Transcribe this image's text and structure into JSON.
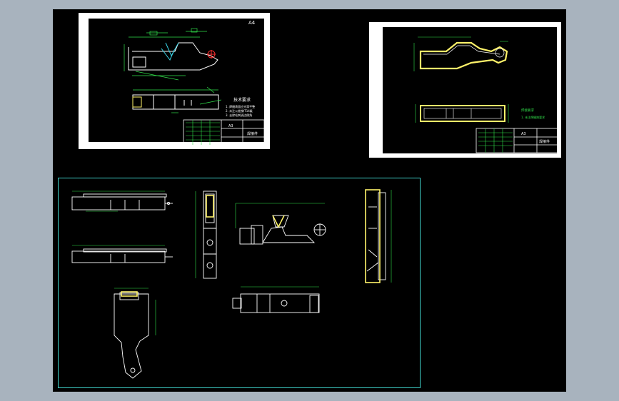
{
  "drawing_sheet_1": {
    "corner_label": "A4",
    "notes_title": "技术要求",
    "notes": [
      "1. 焊缝表面应光滑平整",
      "2. 未注公差按IT14级",
      "3. 去除毛刺锐边倒角"
    ],
    "title_block_name": "焊接件",
    "title_block_code": "A3"
  },
  "drawing_sheet_2": {
    "title_block_name": "焊接件",
    "title_block_code": "A3",
    "note_1": "焊接要求",
    "note_2": "1. 未注焊缝按要求"
  },
  "colors": {
    "workspace": "#a8b3be",
    "canvas": "#000000",
    "sheet_border": "#ffffff",
    "dimension": "#31e04a",
    "highlight": "#fff36a",
    "frame": "#3fd0c8",
    "accent_red": "#ff3030",
    "accent_cyan": "#3ad4e6"
  }
}
